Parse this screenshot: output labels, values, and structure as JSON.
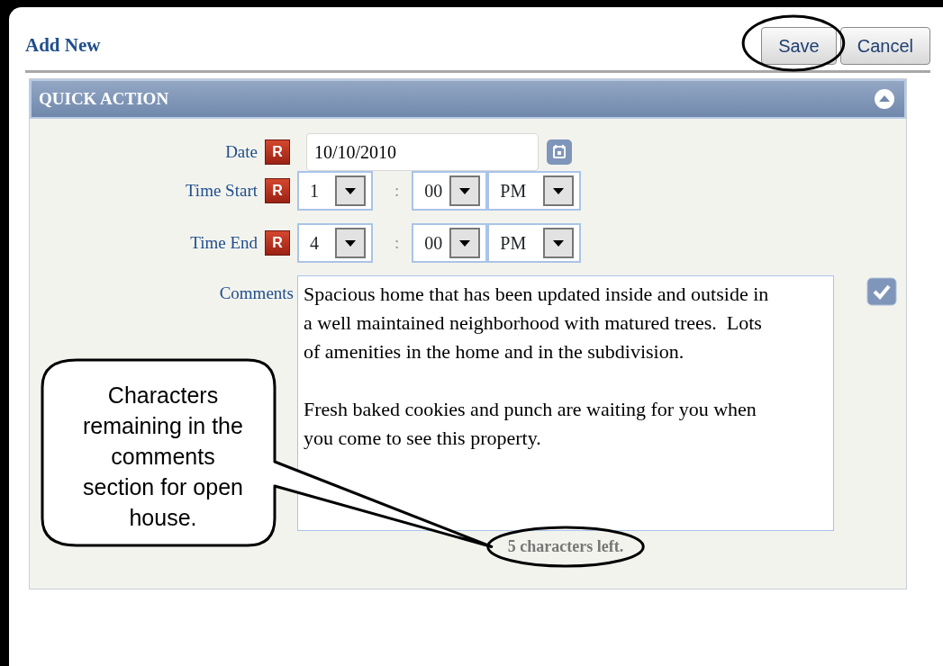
{
  "dialog": {
    "title": "Add New",
    "buttons": [
      {
        "label": "Save",
        "circled": true
      },
      {
        "label": "Cancel",
        "circled": false
      }
    ]
  },
  "section": {
    "title": "QUICK ACTION",
    "expanded": true,
    "separator": ":",
    "date": {
      "label": "Date",
      "required_mark": "R",
      "value": "10/10/2010"
    },
    "times": [
      {
        "label": "Time Start",
        "required_mark": "R",
        "hour": "1",
        "minute": "00",
        "period": "PM"
      },
      {
        "label": "Time End",
        "required_mark": "R",
        "hour": "4",
        "minute": "00",
        "period": "PM"
      }
    ],
    "comments": {
      "label": "Comments",
      "value": "Spacious home that has been updated inside and outside in a well maintained neighborhood with matured trees.  Lots of amenities in the home and in the subdivision.\n\nFresh baked cookies and punch are waiting for you when you come to see this property.",
      "remaining": "5 characters left.",
      "remaining_circled": true
    }
  },
  "callout": {
    "text": "Characters remaining in the comments section for open house."
  }
}
